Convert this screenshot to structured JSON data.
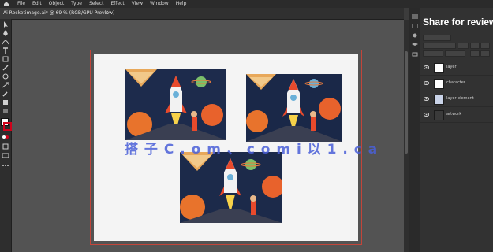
{
  "menubar": {
    "items": [
      "File",
      "Edit",
      "Object",
      "Type",
      "Select",
      "Effect",
      "View",
      "Window",
      "Help"
    ]
  },
  "document_tab": {
    "title": "Ai Rocketimage.ai* @ 69 % (RGB/GPU Preview)"
  },
  "canvas": {
    "watermark": "搭 子 C . o m 、 c o m i 以 1 . c a"
  },
  "right_panel": {
    "title": "Share for review",
    "layers": [
      {
        "name": "layer"
      },
      {
        "name": "character"
      },
      {
        "name": "layer element"
      },
      {
        "name": "artwork"
      }
    ]
  },
  "colors": {
    "accent_red": "#d0021b",
    "artboard": "#f4f4f4",
    "workspace": "#535353"
  }
}
